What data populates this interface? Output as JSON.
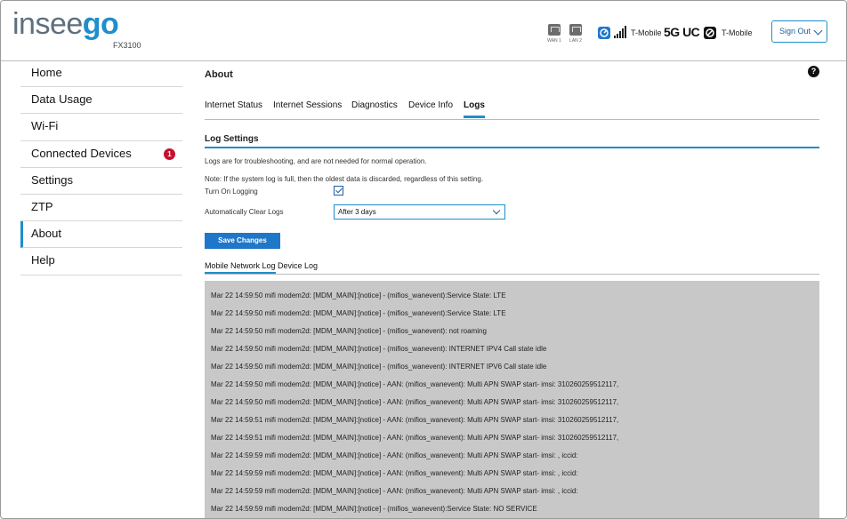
{
  "brand": {
    "logo_prefix": "insee",
    "logo_suffix": "go",
    "model": "FX3100"
  },
  "status": {
    "ports": [
      "WAN 1",
      "LAN 2"
    ],
    "carrier_primary": "T-Mobile",
    "network_type": "5G UC",
    "carrier_secondary": "T-Mobile",
    "signal_bars": 5
  },
  "header": {
    "sign_out_label": "Sign Out"
  },
  "sidebar": {
    "items": [
      {
        "label": "Home"
      },
      {
        "label": "Data Usage"
      },
      {
        "label": "Wi-Fi"
      },
      {
        "label": "Connected Devices",
        "badge": "1"
      },
      {
        "label": "Settings"
      },
      {
        "label": "ZTP"
      },
      {
        "label": "About",
        "active": true
      },
      {
        "label": "Help"
      }
    ]
  },
  "main": {
    "title": "About",
    "help_label": "?",
    "tabs": [
      "Internet Status",
      "Internet Sessions",
      "Diagnostics",
      "Device Info",
      "Logs"
    ],
    "active_tab": "Logs",
    "log_settings": {
      "title": "Log Settings",
      "description": "Logs are for troubleshooting, and are not needed for normal operation.",
      "note": "Note: If the system log is full, then the oldest data is discarded, regardless of this setting.",
      "turn_on_label": "Turn On Logging",
      "turn_on_checked": true,
      "auto_clear_label": "Automatically Clear Logs",
      "auto_clear_value": "After 3 days",
      "save_label": "Save Changes"
    },
    "log_tabs": [
      "Mobile Network Log",
      "Device Log"
    ],
    "active_log_tab": "Mobile Network Log",
    "log_lines": [
      "Mar 22 14:59:50 mifi modem2d: [MDM_MAIN]:[notice] - (mifios_wanevent):Service State: LTE",
      "Mar 22 14:59:50 mifi modem2d: [MDM_MAIN]:[notice] - (mifios_wanevent):Service State: LTE",
      "Mar 22 14:59:50 mifi modem2d: [MDM_MAIN]:[notice] - (mifios_wanevent): not roaming",
      "Mar 22 14:59:50 mifi modem2d: [MDM_MAIN]:[notice] - (mifios_wanevent): INTERNET IPV4 Call state idle",
      "Mar 22 14:59:50 mifi modem2d: [MDM_MAIN]:[notice] - (mifios_wanevent): INTERNET IPV6 Call state idle",
      "Mar 22 14:59:50 mifi modem2d: [MDM_MAIN]:[notice] - AAN: (mifios_wanevent): Multi APN SWAP start- imsi: 310260259512117,",
      "Mar 22 14:59:50 mifi modem2d: [MDM_MAIN]:[notice] - AAN: (mifios_wanevent): Multi APN SWAP start- imsi: 310260259512117,",
      "Mar 22 14:59:51 mifi modem2d: [MDM_MAIN]:[notice] - AAN: (mifios_wanevent): Multi APN SWAP start- imsi: 310260259512117,",
      "Mar 22 14:59:51 mifi modem2d: [MDM_MAIN]:[notice] - AAN: (mifios_wanevent): Multi APN SWAP start- imsi: 310260259512117,",
      "Mar 22 14:59:59 mifi modem2d: [MDM_MAIN]:[notice] - AAN: (mifios_wanevent): Multi APN SWAP start- imsi: , iccid:",
      "Mar 22 14:59:59 mifi modem2d: [MDM_MAIN]:[notice] - AAN: (mifios_wanevent): Multi APN SWAP start- imsi: , iccid:",
      "Mar 22 14:59:59 mifi modem2d: [MDM_MAIN]:[notice] - AAN: (mifios_wanevent): Multi APN SWAP start- imsi: , iccid:",
      "Mar 22 14:59:59 mifi modem2d: [MDM_MAIN]:[notice] - (mifios_wanevent):Service State: NO SERVICE"
    ]
  },
  "colors": {
    "accent": "#1f8ecb",
    "button": "#1f77c9",
    "badge": "#c8102e",
    "log_bg": "#c8c8c8"
  },
  "icons": [
    "ethernet-port-icon",
    "signal-bars-icon",
    "sim-icon",
    "chevron-down-icon",
    "help-icon",
    "checkmark-icon"
  ]
}
